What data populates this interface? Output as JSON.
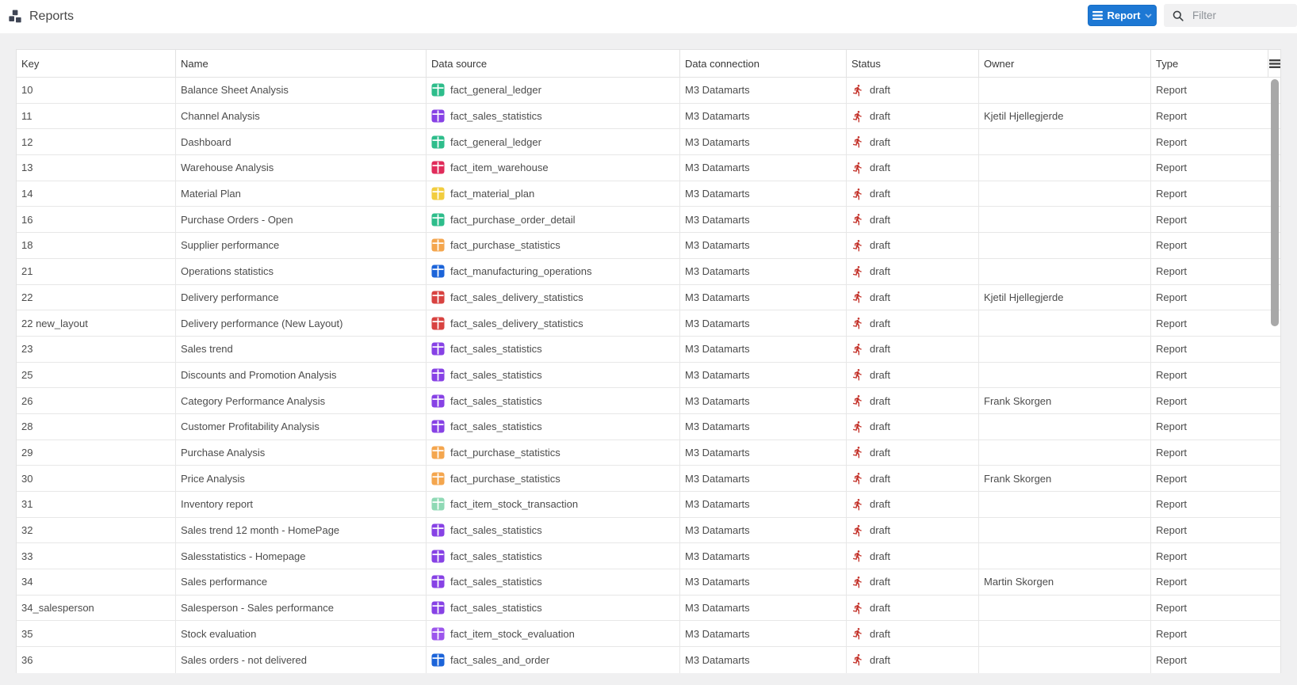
{
  "app": {
    "title": "Reports",
    "toolbar": {
      "report_button_label": "Report",
      "filter_placeholder": "Filter"
    }
  },
  "colors": {
    "accent_blue": "#1d78d4",
    "status_draft_red": "#c4342c"
  },
  "icons": {
    "logo": "cubes-icon",
    "report_button": "menu-icon, chevron-down-icon",
    "filter": "search-icon",
    "table_header_right": "menu-icon",
    "data_source": "table-grid-icon",
    "status": "runner-icon"
  },
  "table": {
    "columns": [
      "Key",
      "Name",
      "Data source",
      "Data connection",
      "Status",
      "Owner",
      "Type"
    ],
    "rows": [
      {
        "key": "10",
        "name": "Balance Sheet Analysis",
        "data_source": "fact_general_ledger",
        "data_source_color": "#2ebd8b",
        "data_connection": "M3 Datamarts",
        "status": "draft",
        "owner": "",
        "type": "Report"
      },
      {
        "key": "11",
        "name": "Channel Analysis",
        "data_source": "fact_sales_statistics",
        "data_source_color": "#8742e5",
        "data_connection": "M3 Datamarts",
        "status": "draft",
        "owner": "Kjetil Hjellegjerde",
        "type": "Report"
      },
      {
        "key": "12",
        "name": "Dashboard",
        "data_source": "fact_general_ledger",
        "data_source_color": "#2ebd8b",
        "data_connection": "M3 Datamarts",
        "status": "draft",
        "owner": "",
        "type": "Report"
      },
      {
        "key": "13",
        "name": "Warehouse Analysis",
        "data_source": "fact_item_warehouse",
        "data_source_color": "#e02c5b",
        "data_connection": "M3 Datamarts",
        "status": "draft",
        "owner": "",
        "type": "Report"
      },
      {
        "key": "14",
        "name": "Material Plan",
        "data_source": "fact_material_plan",
        "data_source_color": "#f2cd3f",
        "data_connection": "M3 Datamarts",
        "status": "draft",
        "owner": "",
        "type": "Report"
      },
      {
        "key": "16",
        "name": "Purchase Orders - Open",
        "data_source": "fact_purchase_order_detail",
        "data_source_color": "#2ebd8b",
        "data_connection": "M3 Datamarts",
        "status": "draft",
        "owner": "",
        "type": "Report"
      },
      {
        "key": "18",
        "name": "Supplier performance",
        "data_source": "fact_purchase_statistics",
        "data_source_color": "#f4a64e",
        "data_connection": "M3 Datamarts",
        "status": "draft",
        "owner": "",
        "type": "Report"
      },
      {
        "key": "21",
        "name": "Operations statistics",
        "data_source": "fact_manufacturing_operations",
        "data_source_color": "#1c64d9",
        "data_connection": "M3 Datamarts",
        "status": "draft",
        "owner": "",
        "type": "Report"
      },
      {
        "key": "22",
        "name": "Delivery performance",
        "data_source": "fact_sales_delivery_statistics",
        "data_source_color": "#d84341",
        "data_connection": "M3 Datamarts",
        "status": "draft",
        "owner": "Kjetil Hjellegjerde",
        "type": "Report"
      },
      {
        "key": "22 new_layout",
        "name": "Delivery performance (New Layout)",
        "data_source": "fact_sales_delivery_statistics",
        "data_source_color": "#d84341",
        "data_connection": "M3 Datamarts",
        "status": "draft",
        "owner": "",
        "type": "Report"
      },
      {
        "key": "23",
        "name": "Sales trend",
        "data_source": "fact_sales_statistics",
        "data_source_color": "#8742e5",
        "data_connection": "M3 Datamarts",
        "status": "draft",
        "owner": "",
        "type": "Report"
      },
      {
        "key": "25",
        "name": "Discounts and Promotion Analysis",
        "data_source": "fact_sales_statistics",
        "data_source_color": "#8742e5",
        "data_connection": "M3 Datamarts",
        "status": "draft",
        "owner": "",
        "type": "Report"
      },
      {
        "key": "26",
        "name": "Category Performance Analysis",
        "data_source": "fact_sales_statistics",
        "data_source_color": "#8742e5",
        "data_connection": "M3 Datamarts",
        "status": "draft",
        "owner": "Frank Skorgen",
        "type": "Report"
      },
      {
        "key": "28",
        "name": "Customer Profitability Analysis",
        "data_source": "fact_sales_statistics",
        "data_source_color": "#8742e5",
        "data_connection": "M3 Datamarts",
        "status": "draft",
        "owner": "",
        "type": "Report"
      },
      {
        "key": "29",
        "name": "Purchase Analysis",
        "data_source": "fact_purchase_statistics",
        "data_source_color": "#f4a64e",
        "data_connection": "M3 Datamarts",
        "status": "draft",
        "owner": "",
        "type": "Report"
      },
      {
        "key": "30",
        "name": "Price Analysis",
        "data_source": "fact_purchase_statistics",
        "data_source_color": "#f4a64e",
        "data_connection": "M3 Datamarts",
        "status": "draft",
        "owner": "Frank Skorgen",
        "type": "Report"
      },
      {
        "key": "31",
        "name": "Inventory report",
        "data_source": "fact_item_stock_transaction",
        "data_source_color": "#8fd9b5",
        "data_connection": "M3 Datamarts",
        "status": "draft",
        "owner": "",
        "type": "Report"
      },
      {
        "key": "32",
        "name": "Sales trend 12 month - HomePage",
        "data_source": "fact_sales_statistics",
        "data_source_color": "#8742e5",
        "data_connection": "M3 Datamarts",
        "status": "draft",
        "owner": "",
        "type": "Report"
      },
      {
        "key": "33",
        "name": "Salesstatistics - Homepage",
        "data_source": "fact_sales_statistics",
        "data_source_color": "#8742e5",
        "data_connection": "M3 Datamarts",
        "status": "draft",
        "owner": "",
        "type": "Report"
      },
      {
        "key": "34",
        "name": "Sales performance",
        "data_source": "fact_sales_statistics",
        "data_source_color": "#8742e5",
        "data_connection": "M3 Datamarts",
        "status": "draft",
        "owner": "Martin Skorgen",
        "type": "Report"
      },
      {
        "key": "34_salesperson",
        "name": "Salesperson - Sales performance",
        "data_source": "fact_sales_statistics",
        "data_source_color": "#8742e5",
        "data_connection": "M3 Datamarts",
        "status": "draft",
        "owner": "",
        "type": "Report"
      },
      {
        "key": "35",
        "name": "Stock evaluation",
        "data_source": "fact_item_stock_evaluation",
        "data_source_color": "#9c55ec",
        "data_connection": "M3 Datamarts",
        "status": "draft",
        "owner": "",
        "type": "Report"
      },
      {
        "key": "36",
        "name": "Sales orders - not delivered",
        "data_source": "fact_sales_and_order",
        "data_source_color": "#1c64d9",
        "data_connection": "M3 Datamarts",
        "status": "draft",
        "owner": "",
        "type": "Report"
      }
    ]
  }
}
